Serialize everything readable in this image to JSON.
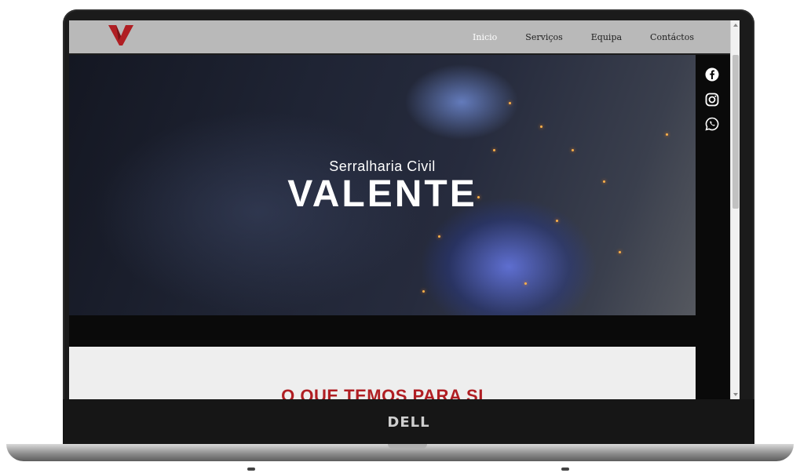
{
  "device": {
    "brand": "DELL"
  },
  "site": {
    "nav": {
      "items": [
        {
          "label": "Inicio",
          "active": true
        },
        {
          "label": "Serviços",
          "active": false
        },
        {
          "label": "Equipa",
          "active": false
        },
        {
          "label": "Contáctos",
          "active": false
        }
      ]
    },
    "hero": {
      "subtitle": "Serralharia Civil",
      "title": "VALENTE"
    },
    "section": {
      "title": "O QUE TEMOS PARA SI"
    },
    "social": [
      "facebook-icon",
      "instagram-icon",
      "whatsapp-icon"
    ]
  },
  "colors": {
    "brand_red": "#b01e23",
    "nav_bg": "#b9b9b9",
    "nav_active": "#ffffff",
    "dark": "#0a0a0a"
  }
}
